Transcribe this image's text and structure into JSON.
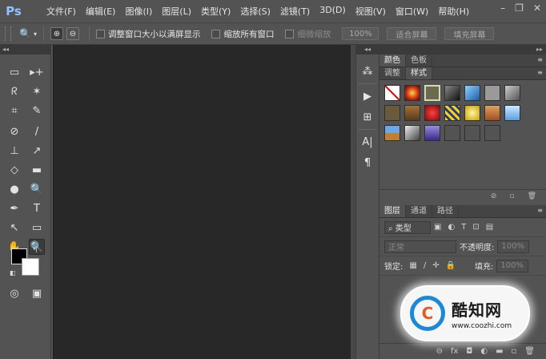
{
  "app": {
    "logo": "Ps"
  },
  "menu": [
    "文件(F)",
    "编辑(E)",
    "图像(I)",
    "图层(L)",
    "类型(Y)",
    "选择(S)",
    "滤镜(T)",
    "3D(D)",
    "视图(V)",
    "窗口(W)",
    "帮助(H)"
  ],
  "window_controls": {
    "minimize": "–",
    "restore": "❐",
    "close": "✕"
  },
  "options": {
    "tool_icon": "🔍",
    "zoom_in": "⊕",
    "zoom_out": "⊖",
    "resize_windows": "调整窗口大小以满屏显示",
    "zoom_all": "缩放所有窗口",
    "scrubby_zoom": "细微缩放",
    "zoom_percent": "100%",
    "fit_screen": "适合屏幕",
    "fill_screen": "填充屏幕"
  },
  "toolbox": {
    "collapse": "◂◂",
    "tools": [
      [
        "▭",
        "▸+"
      ],
      [
        "ᖇ",
        "✶"
      ],
      [
        "⌗",
        "✎"
      ],
      [
        "⊘",
        "/"
      ],
      [
        "⊥",
        "↗"
      ],
      [
        "◇",
        "▬"
      ],
      [
        "●",
        "🔍"
      ],
      [
        "✒",
        "T"
      ],
      [
        "↖",
        "▭"
      ],
      [
        "✋",
        "🔍"
      ]
    ],
    "swap": "↰",
    "default": "◧",
    "quick_mask": "◎",
    "screen_mode": "▣"
  },
  "dock": {
    "collapse": "◂◂",
    "icons": [
      "⁂",
      "▶",
      "⊞",
      "A|",
      "¶"
    ]
  },
  "panels": {
    "expand": "▸▸",
    "top_tabs": [
      "颜色",
      "色板"
    ],
    "style_tabs": [
      "调整",
      "样式"
    ],
    "style_footer_icons": [
      "⊘",
      "▫",
      "🗑"
    ],
    "layer_tabs": [
      "图层",
      "通道",
      "路径"
    ],
    "filter_label": "⌕ 类型",
    "blend_mode": "正常",
    "opacity_label": "不透明度:",
    "opacity_value": "100%",
    "lock_label": "锁定:",
    "fill_label": "填充:",
    "fill_value": "100%",
    "layer_footer_icons": [
      "⊖",
      "fx",
      "◘",
      "◐",
      "▬",
      "▫",
      "🗑"
    ]
  },
  "watermark": {
    "logo": "C",
    "title": "酷知网",
    "url": "www.coozhi.com"
  },
  "colors": {
    "canvas": "#282828",
    "ui": "#535353",
    "accent": "#1c89d8"
  }
}
